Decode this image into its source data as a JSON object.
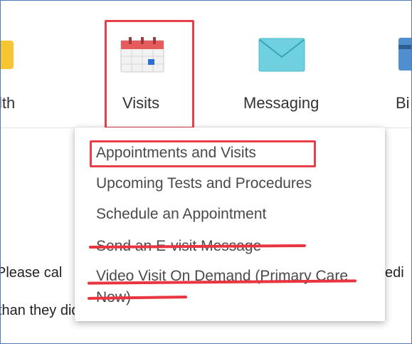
{
  "nav": {
    "items": [
      {
        "label": "lth",
        "icon": "heart-icon"
      },
      {
        "label": "Visits",
        "icon": "calendar-icon"
      },
      {
        "label": "Messaging",
        "icon": "envelope-icon"
      },
      {
        "label": "Bi",
        "icon": "billing-icon"
      }
    ]
  },
  "visits_menu": {
    "items": [
      {
        "label": "Appointments and Visits",
        "highlighted": true,
        "struck_out": false
      },
      {
        "label": "Upcoming Tests and Procedures",
        "highlighted": false,
        "struck_out": false
      },
      {
        "label": "Schedule an Appointment",
        "highlighted": false,
        "struck_out": false
      },
      {
        "label": "Send an E-visit Message",
        "highlighted": false,
        "struck_out": true
      },
      {
        "label": "Video Visit On Demand (Primary Care Now)",
        "highlighted": false,
        "struck_out": true
      }
    ]
  },
  "page": {
    "line1_left": "Please cal",
    "line1_right": "edi",
    "line2": "than they did before; and some processes have char"
  },
  "colors": {
    "frame_border": "#4f79b8",
    "annotation_red": "#e8404a",
    "menu_text": "#4a4a4a"
  }
}
